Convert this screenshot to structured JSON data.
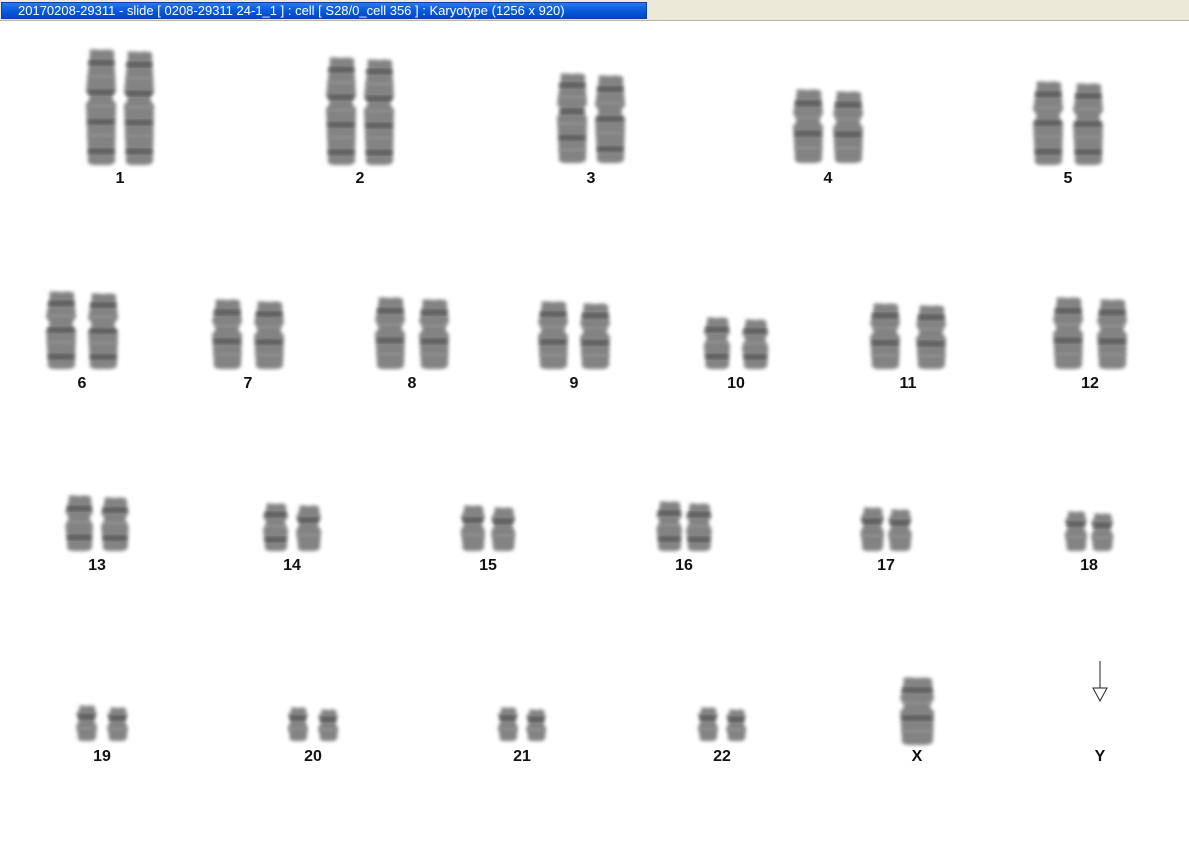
{
  "window": {
    "title": "20170208-29311 - slide [ 0208-29311 24-1_1 ] : cell [ S28/0_cell 356 ] : Karyotype  (1256 x 920)"
  },
  "karyotype": {
    "chromosomes": [
      {
        "id": "1"
      },
      {
        "id": "2"
      },
      {
        "id": "3"
      },
      {
        "id": "4"
      },
      {
        "id": "5"
      },
      {
        "id": "6"
      },
      {
        "id": "7"
      },
      {
        "id": "8"
      },
      {
        "id": "9"
      },
      {
        "id": "10"
      },
      {
        "id": "11"
      },
      {
        "id": "12"
      },
      {
        "id": "13"
      },
      {
        "id": "14"
      },
      {
        "id": "15"
      },
      {
        "id": "16"
      },
      {
        "id": "17"
      },
      {
        "id": "18"
      },
      {
        "id": "19"
      },
      {
        "id": "20"
      },
      {
        "id": "21"
      },
      {
        "id": "22"
      },
      {
        "id": "X"
      },
      {
        "id": "Y"
      }
    ],
    "colors": {
      "chromatid": "#6e6e6e",
      "band": "#3e3e3e",
      "label": "#111111"
    }
  }
}
